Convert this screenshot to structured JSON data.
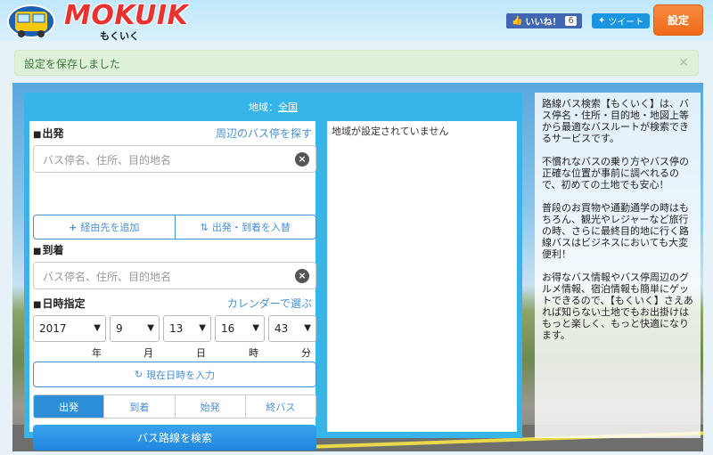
{
  "header": {
    "logo_text": "MOKUIK",
    "logo_sub": "もくいく",
    "like_label": "いいね！",
    "like_count": "6",
    "tweet_label": "ツイート",
    "settings_label": "設定"
  },
  "alert": {
    "message": "設定を保存しました",
    "close": "×"
  },
  "region": {
    "prefix": "地域：",
    "value": "全国"
  },
  "form": {
    "departure_label": "出発",
    "nearby_link": "周辺のバス停を探す",
    "departure_placeholder": "バス停名、住所、目的地名",
    "add_via": "経由先を追加",
    "swap": "出発・到着を入替",
    "arrival_label": "到着",
    "arrival_placeholder": "バス停名、住所、目的地名",
    "datetime_label": "日時指定",
    "calendar_link": "カレンダーで選ぶ",
    "year": "2017",
    "month": "9",
    "day": "13",
    "hour": "16",
    "minute": "43",
    "unit_year": "年",
    "unit_month": "月",
    "unit_day": "日",
    "unit_hour": "時",
    "unit_minute": "分",
    "now_button": "現在日時を入力",
    "tabs": [
      "出発",
      "到着",
      "始発",
      "終バス"
    ],
    "search_button": "バス路線を検索"
  },
  "result": {
    "message": "地域が設定されていません"
  },
  "description": {
    "p1": "路線バス検索【もくいく】は、バス停名・住所・目的地・地図上等から最適なバスルートが検索できるサービスです。",
    "p2": "不慣れなバスの乗り方やバス停の正確な位置が事前に調べれるので、初めての土地でも安心！",
    "p3": "普段のお買物や通勤通学の時はもちろん、観光やレジャーなど旅行の時、さらに最終目的地に行く路線バスはビジネスにおいても大変便利！",
    "p4": "お得なバス情報やバス停周辺のグルメ情報、宿泊情報も簡単にゲットできるので、【もくいく】さえあれば知らない土地でもお出掛けはもっと楽しく、もっと快適になります。"
  },
  "colors": {
    "accent": "#37b5ea",
    "link": "#4a8fd0",
    "settings": "#f06a1b",
    "alert_bg": "#dff0d8"
  }
}
